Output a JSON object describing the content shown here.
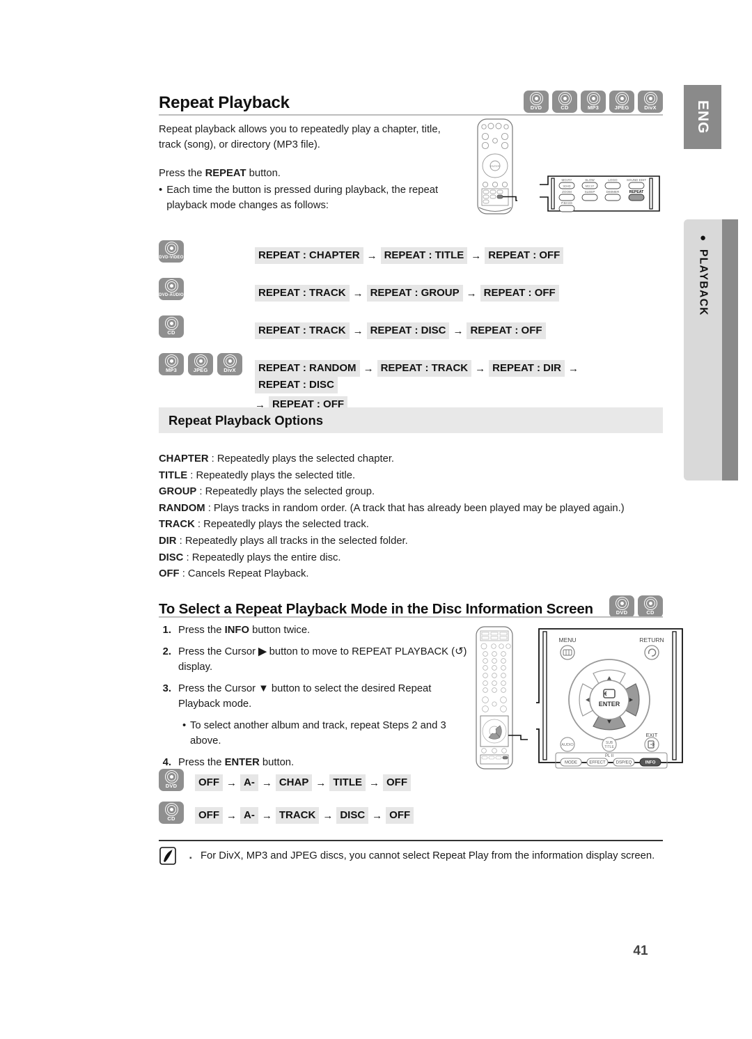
{
  "sidebar": {
    "language_tab": "ENG",
    "section_tab": "PLAYBACK",
    "section_bullet": "●"
  },
  "page_number": "41",
  "header": {
    "title": "Repeat Playback",
    "disc_badges": [
      {
        "label": "DVD"
      },
      {
        "label": "CD"
      },
      {
        "label": "MP3"
      },
      {
        "label": "JPEG"
      },
      {
        "label": "DivX"
      }
    ]
  },
  "intro": {
    "paragraph": "Repeat playback allows you to repeatedly play a chapter, title, track (song), or directory (MP3 file).",
    "press_prefix": "Press the ",
    "press_bold": "REPEAT",
    "press_suffix": " button.",
    "bullet_dot": "•",
    "bullet_text": "Each time the button is pressed during playback, the repeat playback mode changes as follows:"
  },
  "sequences": [
    {
      "icons": [
        {
          "label": "DVD-VIDEO"
        }
      ],
      "chips": [
        "REPEAT : CHAPTER",
        "REPEAT : TITLE",
        "REPEAT : OFF"
      ],
      "arrow": "→",
      "continuation": []
    },
    {
      "icons": [
        {
          "label": "DVD-AUDIO"
        }
      ],
      "chips": [
        "REPEAT : TRACK",
        "REPEAT : GROUP",
        "REPEAT : OFF"
      ],
      "arrow": "→",
      "continuation": []
    },
    {
      "icons": [
        {
          "label": "CD"
        }
      ],
      "chips": [
        "REPEAT : TRACK",
        "REPEAT : DISC",
        "REPEAT : OFF"
      ],
      "arrow": "→",
      "continuation": []
    },
    {
      "icons": [
        {
          "label": "MP3"
        },
        {
          "label": "JPEG"
        },
        {
          "label": "DivX"
        }
      ],
      "chips": [
        "REPEAT : RANDOM",
        "REPEAT : TRACK",
        "REPEAT : DIR",
        "REPEAT : DISC"
      ],
      "arrow": "→",
      "continuation": [
        "REPEAT : OFF"
      ]
    }
  ],
  "options": {
    "bar_title": "Repeat Playback Options",
    "items": [
      {
        "key": "CHAPTER",
        "desc": " : Repeatedly plays the selected chapter."
      },
      {
        "key": "TITLE",
        "desc": " : Repeatedly plays the selected title."
      },
      {
        "key": "GROUP",
        "desc": " : Repeatedly plays the selected group."
      },
      {
        "key": "RANDOM",
        "desc": " : Plays tracks in random order. (A track that has already been played may be played again.)"
      },
      {
        "key": "TRACK",
        "desc": " : Repeatedly plays the selected track."
      },
      {
        "key": "DIR",
        "desc": " : Repeatedly plays all tracks in the selected folder."
      },
      {
        "key": "DISC",
        "desc": " : Repeatedly plays the entire disc."
      },
      {
        "key": "OFF",
        "desc": " : Cancels Repeat Playback."
      }
    ]
  },
  "section2": {
    "title": "To Select a Repeat Playback Mode in the Disc Information Screen",
    "disc_badges": [
      {
        "label": "DVD"
      },
      {
        "label": "CD"
      }
    ],
    "steps": [
      {
        "num": "1.",
        "parts": [
          {
            "t": "Press the ",
            "b": false
          },
          {
            "t": "INFO",
            "b": true
          },
          {
            "t": " button twice.",
            "b": false
          }
        ]
      },
      {
        "num": "2.",
        "parts": [
          {
            "t": "Press the Cursor ",
            "b": false
          },
          {
            "t": "▶",
            "b": true
          },
          {
            "t": " button to move to REPEAT PLAYBACK (↺) display.",
            "b": false
          }
        ]
      },
      {
        "num": "3.",
        "parts": [
          {
            "t": "Press the Cursor ",
            "b": false
          },
          {
            "t": "▼",
            "b": true
          },
          {
            "t": " button to select the desired Repeat Playback mode.",
            "b": false
          }
        ],
        "substep": {
          "dot": "•",
          "text": "To select another album and track, repeat Steps 2 and 3 above."
        }
      },
      {
        "num": "4.",
        "parts": [
          {
            "t": "Press the ",
            "b": false
          },
          {
            "t": "ENTER",
            "b": true
          },
          {
            "t": " button.",
            "b": false
          }
        ]
      }
    ],
    "sequences": [
      {
        "icons": [
          {
            "label": "DVD"
          }
        ],
        "chips": [
          "OFF",
          "A-",
          "CHAP",
          "TITLE",
          "OFF"
        ],
        "arrow": "→"
      },
      {
        "icons": [
          {
            "label": "CD"
          }
        ],
        "chips": [
          "OFF",
          "A-",
          "TRACK",
          "DISC",
          "OFF"
        ],
        "arrow": "→"
      }
    ]
  },
  "note": {
    "square": "▪",
    "text": "For DivX, MP3 and JPEG discs, you cannot select Repeat Play from the information display screen."
  },
  "remote_top": {
    "buttons": [
      {
        "top_label": "MO.RY",
        "label": "SDHD",
        "shape": "pill"
      },
      {
        "top_label": "SLOW",
        "label": "MO.ST",
        "shape": "pill"
      },
      {
        "top_label": "LOGO",
        "label": "",
        "shape": "pill"
      },
      {
        "top_label": "SOUND EDIT",
        "label": "",
        "shape": "pill"
      },
      {
        "top_label": "ZOOM",
        "label": "",
        "shape": "pill"
      },
      {
        "top_label": "SLEEP",
        "label": "",
        "shape": "pill"
      },
      {
        "top_label": "DIMMER",
        "label": "",
        "shape": "pill"
      },
      {
        "top_label": "REPEAT",
        "label": "",
        "shape": "pill",
        "highlight": true
      },
      {
        "top_label": "P.BASS",
        "label": "",
        "shape": "pill"
      }
    ]
  },
  "remote_bottom": {
    "menu_label": "MENU",
    "return_label": "RETURN",
    "enter_label": "ENTER",
    "exit_label": "EXIT",
    "audio_label": "AUDIO",
    "subtitle_label": "SUB TITLE",
    "dsp_group_label": "DSP/EQ",
    "bottom_buttons": [
      "MODE",
      "EFFECT",
      "DSP/EQ",
      "INFO"
    ],
    "pl2_label": "PL II",
    "highlighted": [
      "right-arrow",
      "down-arrow",
      "INFO"
    ]
  },
  "colors": {
    "badge_gray": "#8f8f8f",
    "chip_gray": "#e6e6e6",
    "bar_gray": "#e8e8e8",
    "tab_gray": "#8a8a8a",
    "tab_light": "#d9d9d9",
    "rule_gray": "#bdbdbd"
  }
}
